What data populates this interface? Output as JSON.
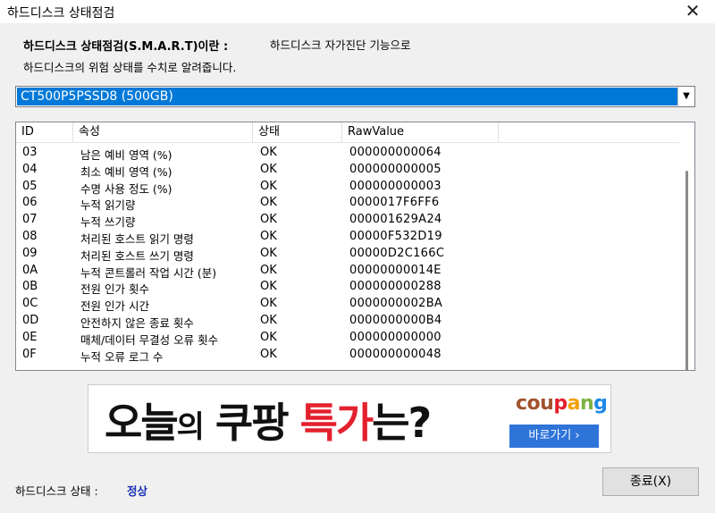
{
  "window": {
    "title": "하드디스크 상태점검",
    "close_glyph": "✕"
  },
  "intro": {
    "label": "하드디스크 상태점검(S.M.A.R.T)이란 :",
    "desc1": "하드디스크 자가진단 기능으로",
    "desc2": "하드디스크의 위험 상태를 수치로 알려줍니다."
  },
  "drive_select": {
    "selected": "CT500P5PSSD8 (500GB)",
    "arrow_glyph": "▼"
  },
  "table": {
    "columns": [
      "ID",
      "속성",
      "상태",
      "RawValue"
    ],
    "rows": [
      [
        "03",
        "남은 예비 영역 (%)",
        "OK",
        "000000000064"
      ],
      [
        "04",
        "최소 예비 영역 (%)",
        "OK",
        "000000000005"
      ],
      [
        "05",
        "수명 사용 정도 (%)",
        "OK",
        "000000000003"
      ],
      [
        "06",
        "누적 읽기량",
        "OK",
        "0000017F6FF6"
      ],
      [
        "07",
        "누적 쓰기량",
        "OK",
        "000001629A24"
      ],
      [
        "08",
        "처리된 호스트 읽기 명령",
        "OK",
        "00000F532D19"
      ],
      [
        "09",
        "처리된 호스트 쓰기 명령",
        "OK",
        "00000D2C166C"
      ],
      [
        "0A",
        "누적 콘트롤러 작업 시간 (분)",
        "OK",
        "00000000014E"
      ],
      [
        "0B",
        "전원 인가 횟수",
        "OK",
        "000000000288"
      ],
      [
        "0C",
        "전원 인가 시간",
        "OK",
        "0000000002BA"
      ],
      [
        "0D",
        "안전하지 않은 종료 횟수",
        "OK",
        "0000000000B4"
      ],
      [
        "0E",
        "매체/데이터 무결성 오류 횟수",
        "OK",
        "000000000000"
      ],
      [
        "0F",
        "누적 오류 로그 수",
        "OK",
        "000000000048"
      ]
    ]
  },
  "ad": {
    "headline_a": "오늘",
    "headline_b": "의",
    "headline_c": " 쿠팡 ",
    "headline_d": "특가",
    "headline_e": "는?",
    "brand": [
      "cou",
      "p",
      "a",
      "n",
      "g"
    ],
    "button_label": "바로가기 ›"
  },
  "footer": {
    "status_label": "하드디스크 상태 :",
    "status_value": "정상",
    "exit_label": "종료(X)"
  },
  "colors": {
    "selection": "#0078d7",
    "status_ok": "#1a2fb5",
    "ad_red": "#e4202d",
    "ad_button": "#2f74d8"
  }
}
